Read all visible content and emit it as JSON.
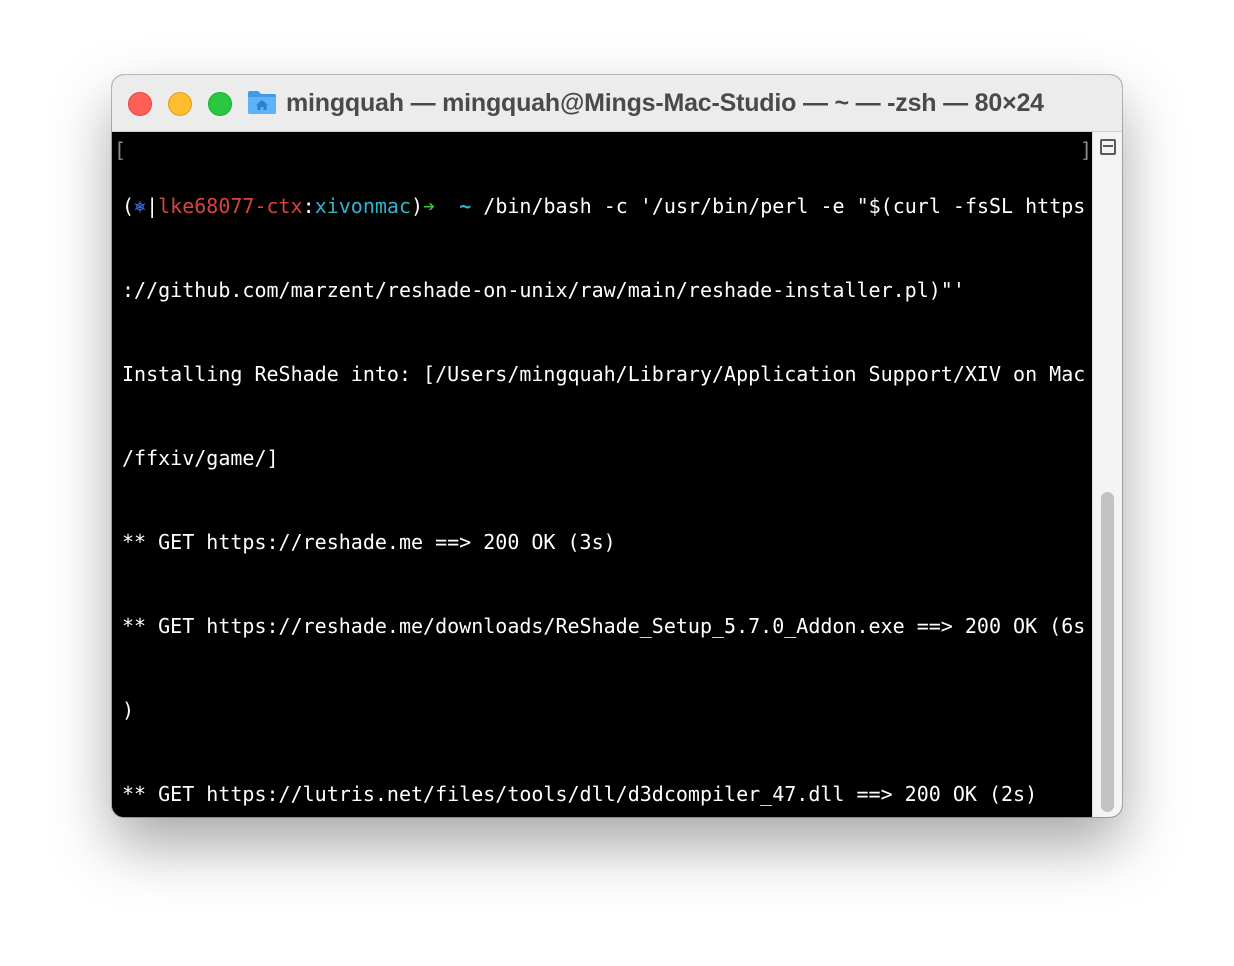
{
  "window": {
    "title": "mingquah — mingquah@Mings-Mac-Studio — ~ — -zsh — 80×24",
    "folder_icon": "home-folder-icon"
  },
  "colors": {
    "ctx": "#d6453d",
    "namespace": "#31b4c9",
    "arrow": "#36c03c",
    "kube_icon": "#3a6df0",
    "background": "#000000",
    "text": "#ffffff"
  },
  "prompt": {
    "open_paren": "(",
    "kube_icon": "⎈",
    "separator": "|",
    "context": "lke68077-ctx",
    "colon": ":",
    "namespace": "xivonmac",
    "close_paren": ")",
    "arrow": "➔",
    "dir": "~"
  },
  "terminal": {
    "command": "/bin/bash -c '/usr/bin/perl -e \"$(curl -fsSL https",
    "command_wrap": "://github.com/marzent/reshade-on-unix/raw/main/reshade-installer.pl)\"'",
    "output": [
      "Installing ReShade into: [/Users/mingquah/Library/Application Support/XIV on Mac",
      "/ffxiv/game/]",
      "** GET https://reshade.me ==> 200 OK (3s)",
      "** GET https://reshade.me/downloads/ReShade_Setup_5.7.0_Addon.exe ==> 200 OK (6s",
      ")",
      "** GET https://lutris.net/files/tools/dll/d3dcompiler_47.dll ==> 200 OK (2s)"
    ]
  }
}
